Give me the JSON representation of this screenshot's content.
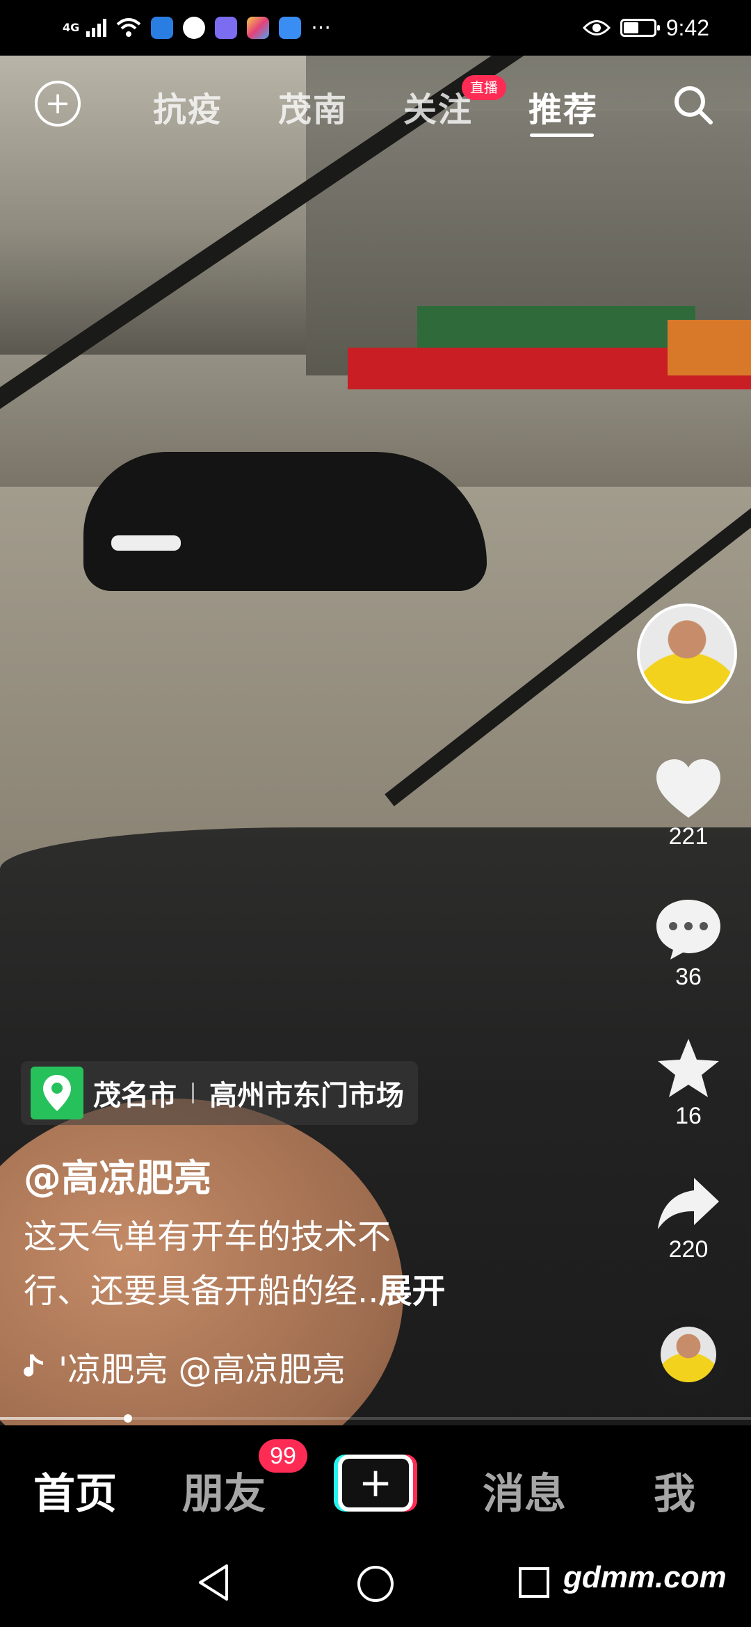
{
  "status_bar": {
    "network": "4G",
    "time": "9:42",
    "battery_level": 0.5,
    "app_icons": [
      "shield-app-icon",
      "browser-app-icon",
      "music-app-icon",
      "gallery-app-icon",
      "weather-app-icon"
    ],
    "more": "···"
  },
  "top_tabs": {
    "items": [
      "抗疫",
      "茂南",
      "关注",
      "推荐"
    ],
    "active": "推荐",
    "live_badge": "直播"
  },
  "sidebar": {
    "likes": "221",
    "comments": "36",
    "favorites": "16",
    "shares": "220"
  },
  "location": {
    "city": "茂名市",
    "place": "高州市东门市场"
  },
  "post": {
    "username": "@高凉肥亮",
    "caption_line1": "这天气单有开车的技术不",
    "caption_line2": "行、还要具备开船的经..",
    "expand": "展开",
    "music_text": "'凉肥亮    @高凉肥亮"
  },
  "video_progress": 0.17,
  "bottom_nav": {
    "items": [
      "首页",
      "朋友",
      "消息",
      "我"
    ],
    "active": "首页",
    "friends_badge": "99",
    "create_label": "+"
  },
  "system_nav": {
    "watermark": "gdmm.com"
  },
  "colors": {
    "accent": "#fe2c55",
    "cyan": "#25f4ee",
    "location_green": "#27c15b"
  }
}
